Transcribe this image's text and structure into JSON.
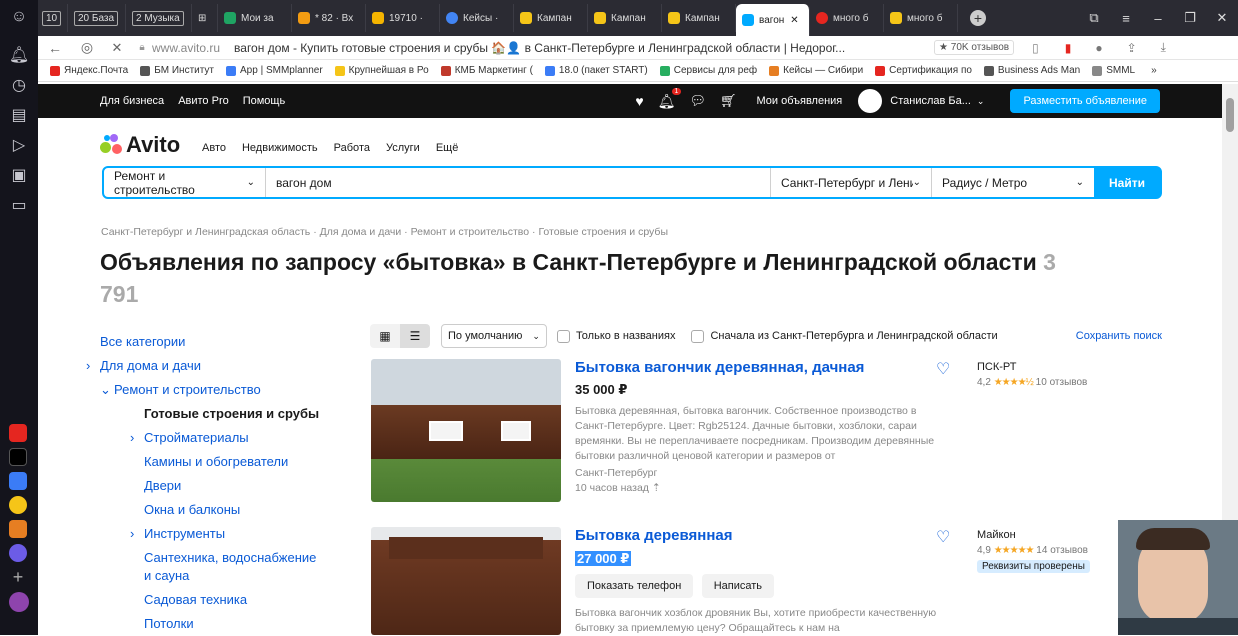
{
  "tabs": [
    {
      "label": "10",
      "type": "badge"
    },
    {
      "label": "20 База",
      "type": "badge"
    },
    {
      "label": "2 Музыка",
      "type": "badge"
    },
    {
      "label": "Мои за",
      "color": "#1fa463"
    },
    {
      "label": "* 82 · Вх",
      "color": "#f39c12"
    },
    {
      "label": "19710 ·",
      "color": "#f4b400"
    },
    {
      "label": "Кейсы ·",
      "color": "#4285f4"
    },
    {
      "label": "Кампан",
      "color": "#f5c518"
    },
    {
      "label": "Кампан",
      "color": "#f5c518"
    },
    {
      "label": "Кампан",
      "color": "#f5c518"
    },
    {
      "label": "вагон",
      "color": "#00aaff",
      "active": true
    },
    {
      "label": "много б",
      "color": "#e52620"
    },
    {
      "label": "много б",
      "color": "#f5c518"
    }
  ],
  "address": {
    "domain": "www.avito.ru",
    "title": "вагон дом - Купить готовые строения и срубы 🏠👤 в Санкт-Петербурге и Ленинградской области | Недорог...",
    "reviews": "★ 70K отзывов"
  },
  "bookmarks": [
    {
      "label": "Яндекс.Почта",
      "color": "#e52620"
    },
    {
      "label": "БМ Институт",
      "color": "#555"
    },
    {
      "label": "App | SMMplanner",
      "color": "#3b7cf6"
    },
    {
      "label": "Крупнейшая в Ро",
      "color": "#f5c518"
    },
    {
      "label": "КМБ Маркетинг (",
      "color": "#c0392b"
    },
    {
      "label": "18.0 (пакет START)",
      "color": "#3b7cf6"
    },
    {
      "label": "Сервисы для реф",
      "color": "#27ae60"
    },
    {
      "label": "Кейсы — Сибири",
      "color": "#e67e22"
    },
    {
      "label": "Сертификация по",
      "color": "#e52620"
    },
    {
      "label": "Business Ads Man",
      "color": "#555"
    },
    {
      "label": "SMML",
      "color": "#888"
    }
  ],
  "topnav": {
    "links": [
      "Для бизнеса",
      "Авито Pro",
      "Помощь"
    ],
    "notif_count": "1",
    "my_ads": "Мои объявления",
    "user": "Станислав Ба...",
    "post_btn": "Разместить объявление"
  },
  "header": {
    "logo": "Avito",
    "nav": [
      "Авто",
      "Недвижимость",
      "Работа",
      "Услуги",
      "Ещё"
    ]
  },
  "search": {
    "category": "Ремонт и строительство",
    "query": "вагон дом",
    "region": "Санкт-Петербург и Ленинг",
    "radius": "Радиус / Метро",
    "button": "Найти"
  },
  "breadcrumbs": [
    "Санкт-Петербург и Ленинградская область",
    "Для дома и дачи",
    "Ремонт и строительство",
    "Готовые строения и срубы"
  ],
  "page_title": "Объявления по запросу «бытовка» в Санкт-Петербурге и Ленинградской области",
  "results_count": "3 791",
  "filters": {
    "sort": "По умолчанию",
    "only_titles": "Только в названиях",
    "local_first": "Сначала из Санкт-Петербурга и Ленинградской области",
    "save": "Сохранить поиск"
  },
  "categories": [
    {
      "label": "Все категории",
      "level": 0,
      "chev": ""
    },
    {
      "label": "Для дома и дачи",
      "level": 1,
      "chev": "›"
    },
    {
      "label": "Ремонт и строительство",
      "level": 2,
      "chev": "⌄"
    },
    {
      "label": "Готовые строения и срубы",
      "level": 3,
      "chev": "",
      "current": true
    },
    {
      "label": "Стройматериалы",
      "level": 3,
      "chev": "›"
    },
    {
      "label": "Камины и обогреватели",
      "level": 3,
      "chev": ""
    },
    {
      "label": "Двери",
      "level": 3,
      "chev": ""
    },
    {
      "label": "Окна и балконы",
      "level": 3,
      "chev": ""
    },
    {
      "label": "Инструменты",
      "level": 3,
      "chev": "›"
    },
    {
      "label": "Сантехника, водоснабжение и сауна",
      "level": 3,
      "chev": ""
    },
    {
      "label": "Садовая техника",
      "level": 3,
      "chev": ""
    },
    {
      "label": "Потолки",
      "level": 3,
      "chev": ""
    }
  ],
  "listings": [
    {
      "title": "Бытовка вагончик деревянная, дачная",
      "price": "35 000 ₽",
      "desc": "Бытовка деревянная, бытовка вагончик. Собственное производство в Санкт-Петербурге. Цвет: Rgb25124. Дачные бытовки, хозблоки, сараи времянки. Вы не переплачиваете посредникам. Производим деревянные бытовки различной ценовой категории и размеров от",
      "location": "Санкт-Петербург",
      "time": "10 часов назад",
      "seller": "ПСК-РТ",
      "rating": "4,2",
      "stars": "★★★★½",
      "reviews": "10 отзывов"
    },
    {
      "title": "Бытовка деревянная",
      "price": "27 000 ₽",
      "btn_phone": "Показать телефон",
      "btn_write": "Написать",
      "desc": "Бытовка вагончик хозблок дровяник Вы, хотите приобрести качественную бытовку за приемлемую цену? Обращайтесь к нам на",
      "seller": "Майкон",
      "rating": "4,9",
      "stars": "★★★★★",
      "reviews": "14 отзывов",
      "badge": "Реквизиты проверены"
    }
  ]
}
